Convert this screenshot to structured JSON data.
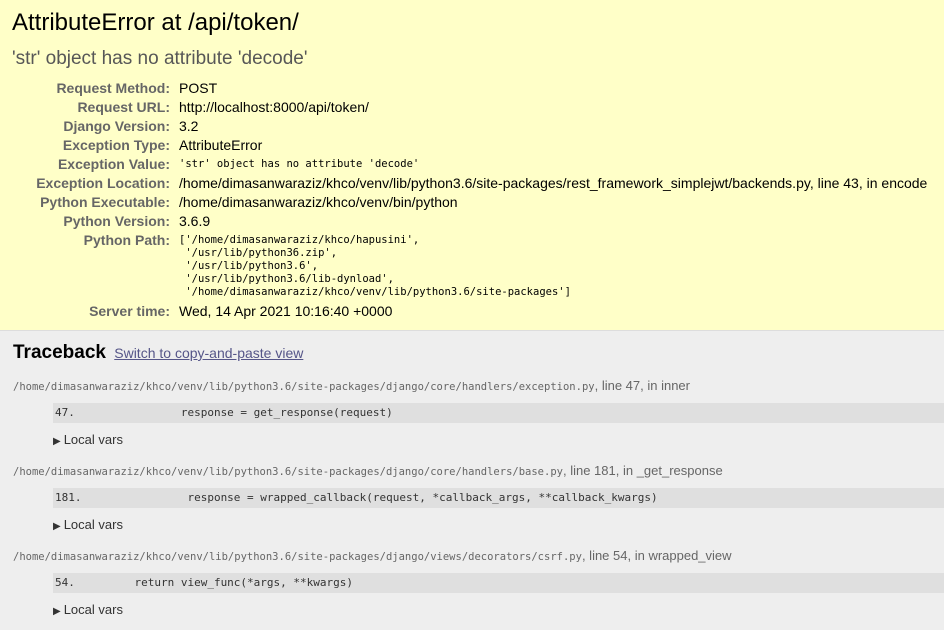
{
  "summary": {
    "title": "AttributeError at /api/token/",
    "message": "'str' object has no attribute 'decode'",
    "meta": [
      {
        "label": "Request Method:",
        "value": "POST"
      },
      {
        "label": "Request URL:",
        "value": "http://localhost:8000/api/token/"
      },
      {
        "label": "Django Version:",
        "value": "3.2"
      },
      {
        "label": "Exception Type:",
        "value": "AttributeError"
      },
      {
        "label": "Exception Value:",
        "value": "'str' object has no attribute 'decode'"
      },
      {
        "label": "Exception Location:",
        "value": "/home/dimasanwaraziz/khco/venv/lib/python3.6/site-packages/rest_framework_simplejwt/backends.py, line 43, in encode"
      },
      {
        "label": "Python Executable:",
        "value": "/home/dimasanwaraziz/khco/venv/bin/python"
      },
      {
        "label": "Python Version:",
        "value": "3.6.9"
      },
      {
        "label": "Python Path:",
        "lines": [
          "['/home/dimasanwaraziz/khco/hapusini',",
          " '/usr/lib/python36.zip',",
          " '/usr/lib/python3.6',",
          " '/usr/lib/python3.6/lib-dynload',",
          " '/home/dimasanwaraziz/khco/venv/lib/python3.6/site-packages']"
        ]
      },
      {
        "label": "Server time:",
        "value": "Wed, 14 Apr 2021 10:16:40 +0000"
      }
    ]
  },
  "traceback": {
    "title": "Traceback",
    "switch_link": "Switch to copy-and-paste view",
    "local_vars_label": "Local vars",
    "frames": [
      {
        "file": "/home/dimasanwaraziz/khco/venv/lib/python3.6/site-packages/django/core/handlers/exception.py",
        "location": ", line 47, in inner",
        "code": "47.                response = get_response(request)"
      },
      {
        "file": "/home/dimasanwaraziz/khco/venv/lib/python3.6/site-packages/django/core/handlers/base.py",
        "location": ", line 181, in _get_response",
        "code": "181.                response = wrapped_callback(request, *callback_args, **callback_kwargs)"
      },
      {
        "file": "/home/dimasanwaraziz/khco/venv/lib/python3.6/site-packages/django/views/decorators/csrf.py",
        "location": ", line 54, in wrapped_view",
        "code": "54.         return view_func(*args, **kwargs)"
      }
    ]
  }
}
